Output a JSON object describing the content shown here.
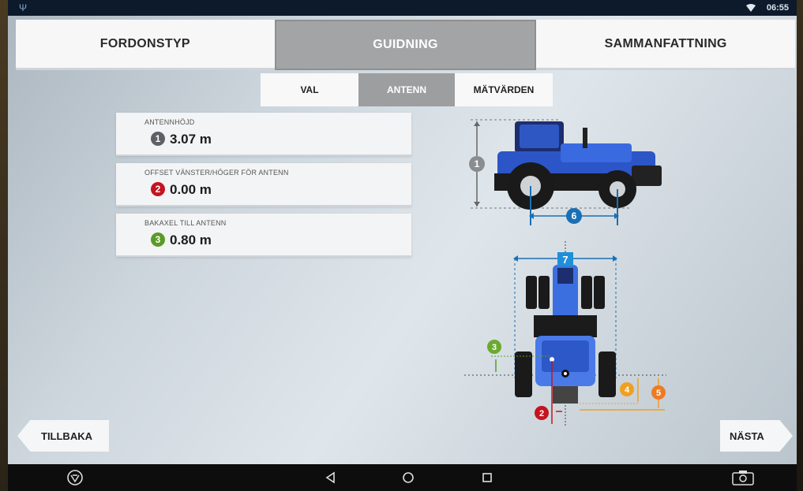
{
  "status_bar": {
    "time": "06:55"
  },
  "tabs": [
    {
      "label": "FORDONSTYP"
    },
    {
      "label": "GUIDNING"
    },
    {
      "label": "SAMMANFATTNING"
    }
  ],
  "subtabs": [
    {
      "label": "VAL"
    },
    {
      "label": "ANTENN"
    },
    {
      "label": "MÄTVÄRDEN"
    }
  ],
  "settings": [
    {
      "label": "ANTENNHÖJD",
      "badge": "1",
      "value": "3.07 m"
    },
    {
      "label": "OFFSET VÄNSTER/HÖGER FÖR ANTENN",
      "badge": "2",
      "value": "0.00 m"
    },
    {
      "label": "BAKAXEL TILL ANTENN",
      "badge": "3",
      "value": "0.80 m"
    }
  ],
  "diagram": {
    "markers": {
      "m1": "1",
      "m2": "2",
      "m3": "3",
      "m4": "4",
      "m5": "5",
      "m6": "6",
      "m7": "7"
    }
  },
  "nav": {
    "back_label": "TILLBAKA",
    "next_label": "NÄSTA"
  },
  "colors": {
    "grey_badge": "#5d6165",
    "red_badge": "#c4141f",
    "green_badge": "#5a9a28",
    "blue_marker": "#1a6fb5",
    "orange_marker": "#f0a020",
    "tractor_blue": "#3b6fe0"
  }
}
